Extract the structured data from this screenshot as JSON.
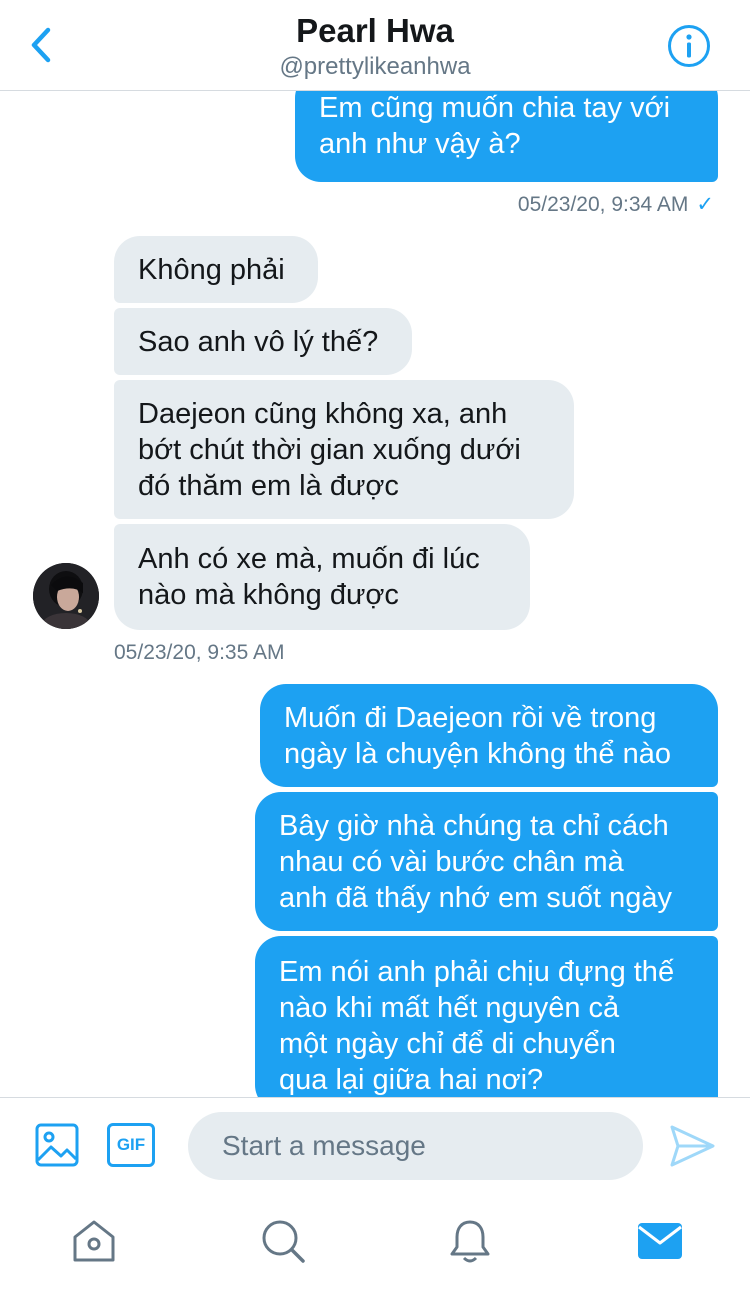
{
  "header": {
    "title": "Pearl Hwa",
    "handle": "@prettylikeanhwa"
  },
  "messages": [
    {
      "side": "sent",
      "lines": [
        "Em cũng muốn chia tay với",
        "anh như vậy à?"
      ]
    },
    {
      "side": "recv",
      "lines": [
        "Không phải"
      ]
    },
    {
      "side": "recv",
      "lines": [
        "Sao anh vô lý thế?"
      ]
    },
    {
      "side": "recv",
      "lines": [
        "Daejeon cũng không xa, anh",
        "bớt chút thời gian xuống dưới",
        "đó thăm em là được"
      ]
    },
    {
      "side": "recv",
      "lines": [
        "Anh có xe mà, muốn đi lúc",
        "nào mà không được"
      ]
    },
    {
      "side": "sent",
      "lines": [
        "Muốn đi Daejeon rồi về trong",
        "ngày là chuyện không thể nào"
      ]
    },
    {
      "side": "sent",
      "lines": [
        "Bây giờ nhà chúng ta chỉ cách",
        "nhau có vài bước chân mà",
        "anh đã thấy nhớ em suốt ngày"
      ]
    },
    {
      "side": "sent",
      "lines": [
        "Em nói anh phải chịu đựng thế",
        "nào khi mất hết nguyên cả",
        "một ngày chỉ để di chuyển",
        "qua lại giữa hai nơi?"
      ]
    }
  ],
  "timestamps": {
    "sent_1": "05/23/20, 9:34 AM",
    "sent_1_check": "✓",
    "recv_1": "05/23/20, 9:35 AM"
  },
  "composer": {
    "placeholder": "Start a message",
    "gif_label": "GIF"
  },
  "icons": {
    "back": "chevron-left-icon",
    "info": "info-icon",
    "media": "image-icon",
    "gif": "gif-icon",
    "send": "send-icon",
    "home": "home-icon",
    "search": "search-icon",
    "notifications": "bell-icon",
    "messages": "mail-icon"
  },
  "colors": {
    "accent": "#1da1f2",
    "received_bubble": "#e6ecf0",
    "secondary_text": "#657786",
    "inactive_icon": "#657786"
  },
  "tabs": {
    "active": "messages"
  }
}
